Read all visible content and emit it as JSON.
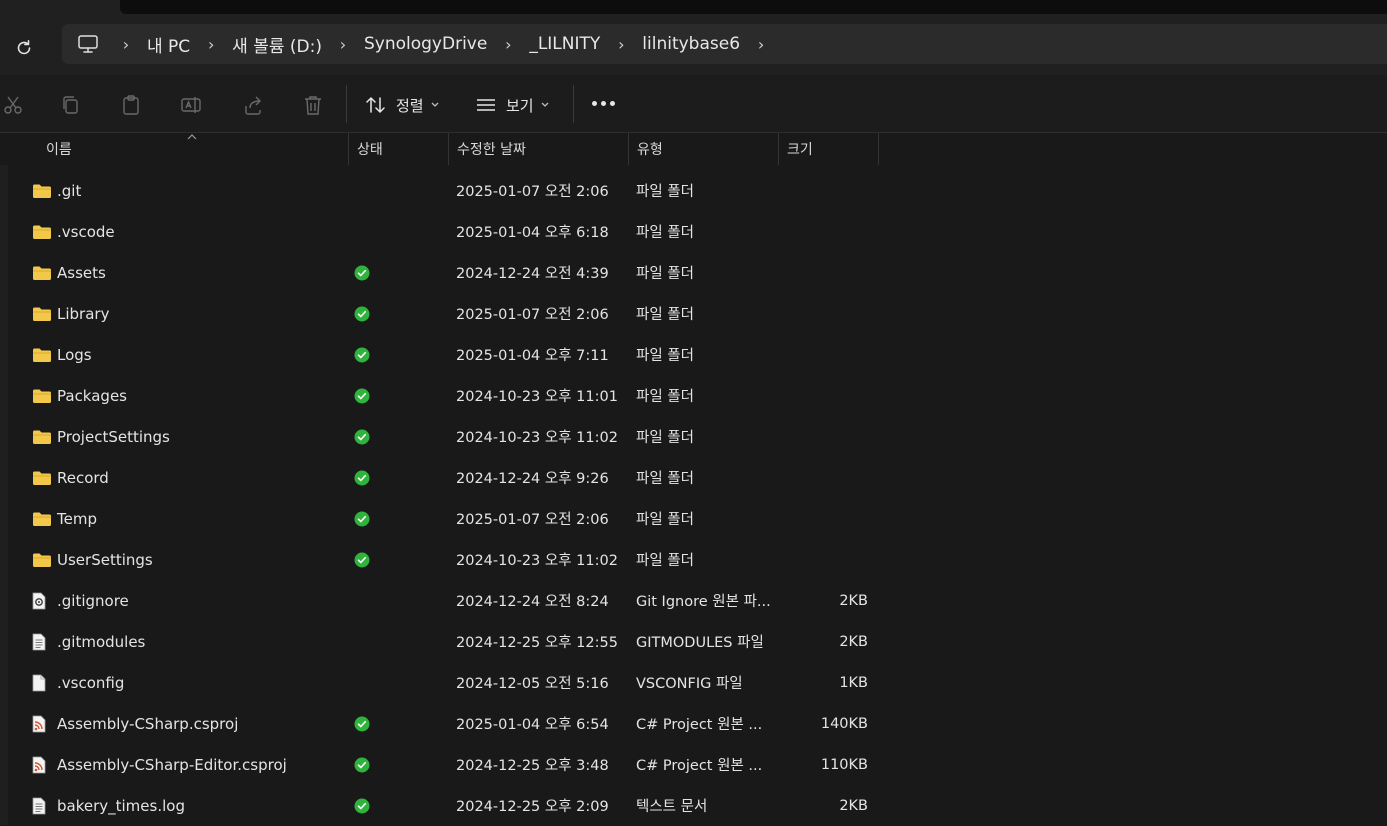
{
  "address": {
    "crumbs": [
      "내 PC",
      "새 볼륨 (D:)",
      "SynologyDrive",
      "_LILNITY",
      "lilnitybase6"
    ]
  },
  "toolbar": {
    "sort_label": "정렬",
    "view_label": "보기"
  },
  "columns": {
    "name": "이름",
    "status": "상태",
    "modified": "수정한 날짜",
    "type": "유형",
    "size": "크기"
  },
  "colors": {
    "folder": "#f2c84b",
    "status_ok": "#2fb33c",
    "csproj": "#d0562f"
  },
  "files": [
    {
      "name": ".git",
      "icon": "folder-icon",
      "synced": false,
      "date": "2025-01-07 오전 2:06",
      "type": "파일 폴더",
      "size": ""
    },
    {
      "name": ".vscode",
      "icon": "folder-icon",
      "synced": false,
      "date": "2025-01-04 오후 6:18",
      "type": "파일 폴더",
      "size": ""
    },
    {
      "name": "Assets",
      "icon": "folder-icon",
      "synced": true,
      "date": "2024-12-24 오전 4:39",
      "type": "파일 폴더",
      "size": ""
    },
    {
      "name": "Library",
      "icon": "folder-icon",
      "synced": true,
      "date": "2025-01-07 오전 2:06",
      "type": "파일 폴더",
      "size": ""
    },
    {
      "name": "Logs",
      "icon": "folder-icon",
      "synced": true,
      "date": "2025-01-04 오후 7:11",
      "type": "파일 폴더",
      "size": ""
    },
    {
      "name": "Packages",
      "icon": "folder-icon",
      "synced": true,
      "date": "2024-10-23 오후 11:01",
      "type": "파일 폴더",
      "size": ""
    },
    {
      "name": "ProjectSettings",
      "icon": "folder-icon",
      "synced": true,
      "date": "2024-10-23 오후 11:02",
      "type": "파일 폴더",
      "size": ""
    },
    {
      "name": "Record",
      "icon": "folder-icon",
      "synced": true,
      "date": "2024-12-24 오후 9:26",
      "type": "파일 폴더",
      "size": ""
    },
    {
      "name": "Temp",
      "icon": "folder-icon",
      "synced": true,
      "date": "2025-01-07 오전 2:06",
      "type": "파일 폴더",
      "size": ""
    },
    {
      "name": "UserSettings",
      "icon": "folder-icon",
      "synced": true,
      "date": "2024-10-23 오후 11:02",
      "type": "파일 폴더",
      "size": ""
    },
    {
      "name": ".gitignore",
      "icon": "gitignore-file-icon",
      "synced": false,
      "date": "2024-12-24 오전 8:24",
      "type": "Git Ignore 원본 파...",
      "size": "2KB"
    },
    {
      "name": ".gitmodules",
      "icon": "text-file-icon",
      "synced": false,
      "date": "2024-12-25 오후 12:55",
      "type": "GITMODULES 파일",
      "size": "2KB"
    },
    {
      "name": ".vsconfig",
      "icon": "blank-file-icon",
      "synced": false,
      "date": "2024-12-05 오전 5:16",
      "type": "VSCONFIG 파일",
      "size": "1KB"
    },
    {
      "name": "Assembly-CSharp.csproj",
      "icon": "csproj-file-icon",
      "synced": true,
      "date": "2025-01-04 오후 6:54",
      "type": "C# Project 원본 ...",
      "size": "140KB"
    },
    {
      "name": "Assembly-CSharp-Editor.csproj",
      "icon": "csproj-file-icon",
      "synced": true,
      "date": "2024-12-25 오후 3:48",
      "type": "C# Project 원본 ...",
      "size": "110KB"
    },
    {
      "name": "bakery_times.log",
      "icon": "text-file-icon",
      "synced": true,
      "date": "2024-12-25 오후 2:09",
      "type": "텍스트 문서",
      "size": "2KB"
    }
  ]
}
